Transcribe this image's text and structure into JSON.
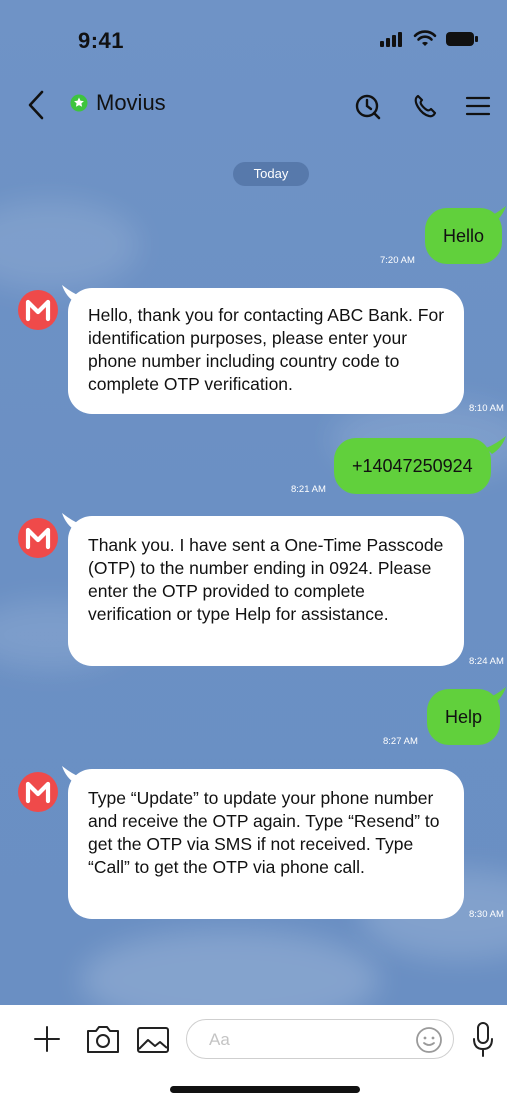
{
  "status_bar": {
    "time": "9:41"
  },
  "header": {
    "back_label": "Back",
    "title": "Movius"
  },
  "date_separator": "Today",
  "messages": [
    {
      "direction": "out",
      "text": "Hello",
      "time": "7:20 AM"
    },
    {
      "direction": "in",
      "text": "Hello, thank you for contacting ABC Bank. For identification purposes, please enter your phone number including country code to complete OTP verification.",
      "time": "8:10 AM"
    },
    {
      "direction": "out",
      "text": "+14047250924",
      "time": "8:21 AM"
    },
    {
      "direction": "in",
      "text": "Thank you. I have sent a One-Time Passcode (OTP) to the number ending in 0924. Please enter the OTP provided to complete verification or type Help for assistance.",
      "time": "8:24 AM"
    },
    {
      "direction": "out",
      "text": "Help",
      "time": "8:27 AM"
    },
    {
      "direction": "in",
      "text": "Type “Update” to update your phone number and receive the OTP again. Type “Resend” to get the OTP via SMS if not received. Type “Call” to get the OTP via phone call.",
      "time": "8:30 AM"
    }
  ],
  "input": {
    "placeholder": "Aa"
  },
  "colors": {
    "outgoing_bubble": "#61d03c",
    "incoming_bubble": "#ffffff",
    "chat_background": "#6e92c5",
    "avatar": "#ef4a4a",
    "verified_badge": "#3ec43e"
  }
}
